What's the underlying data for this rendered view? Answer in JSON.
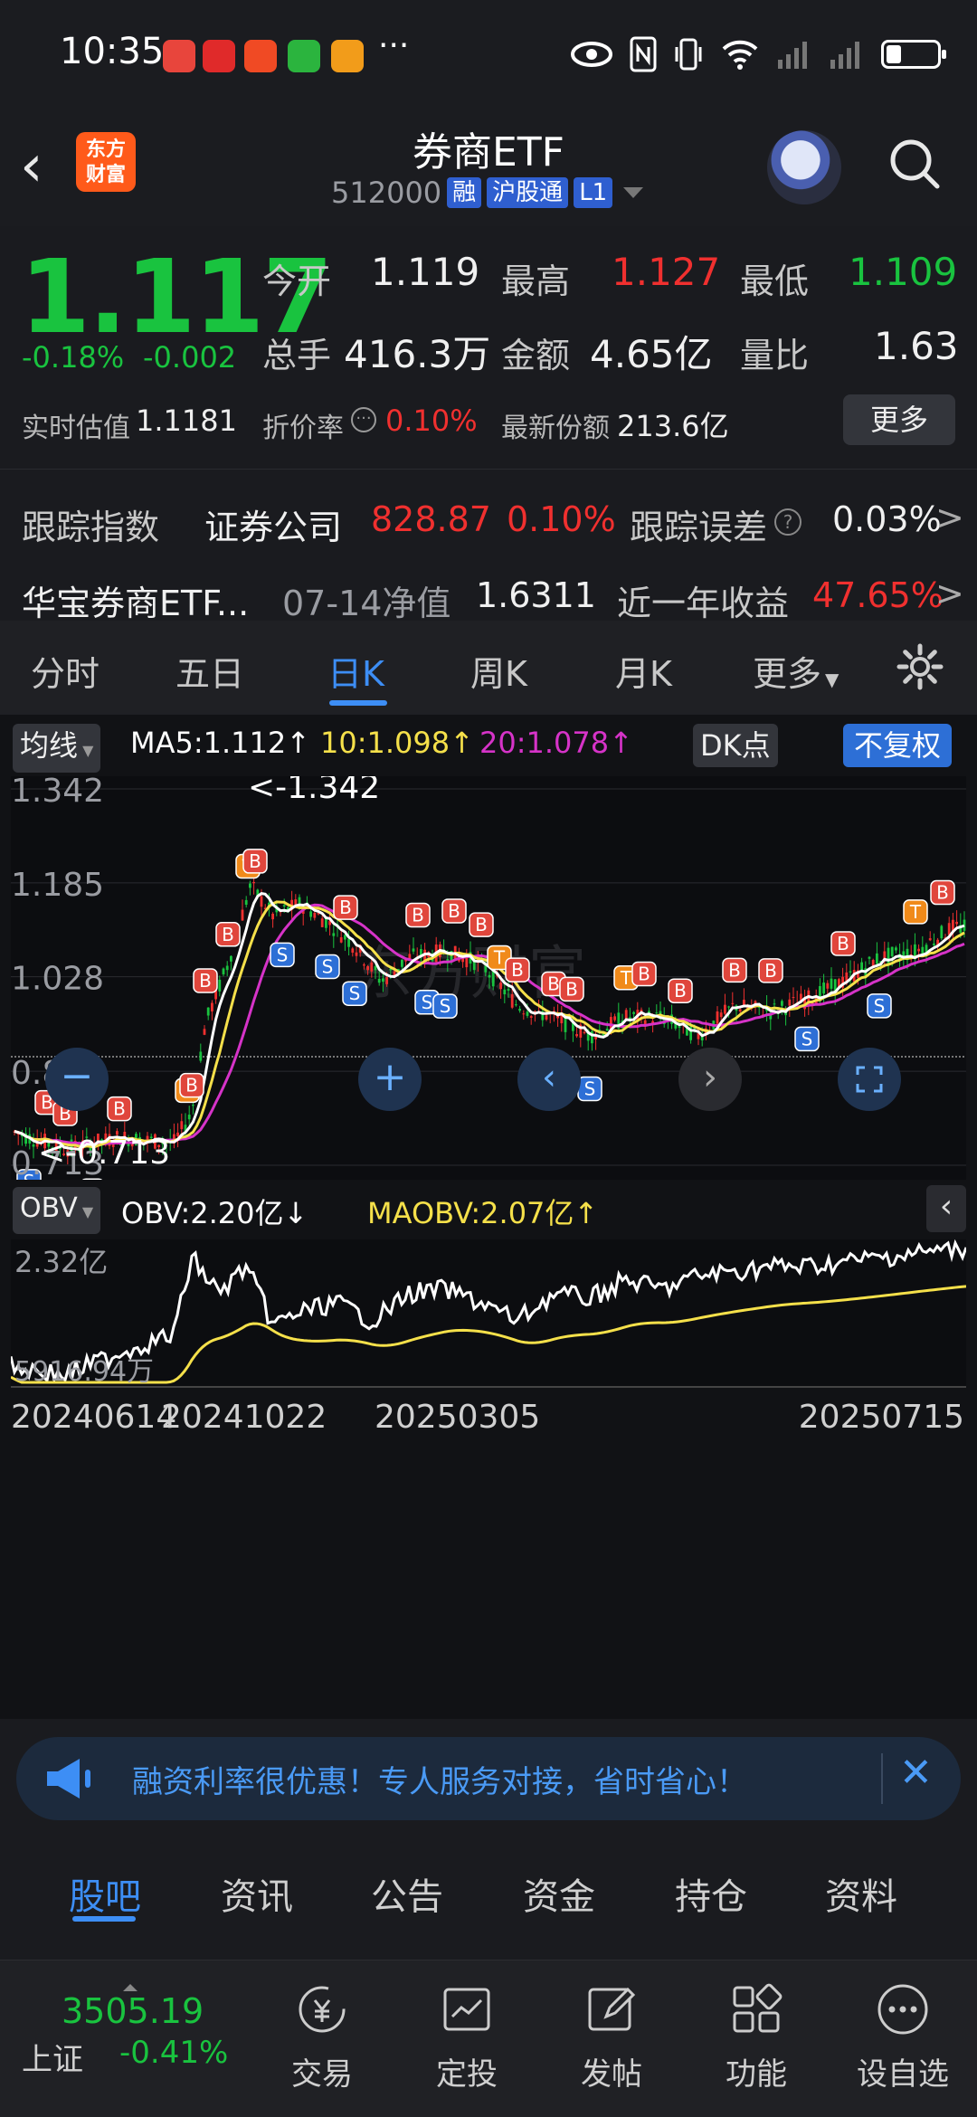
{
  "status_bar": {
    "time": "10:35",
    "dots": "···"
  },
  "header": {
    "brand": "东方\n财富",
    "title": "券商ETF",
    "code": "512000",
    "tags": [
      "融",
      "沪股通",
      "L1"
    ]
  },
  "quote": {
    "price": "1.117",
    "change_pct": "-0.18%",
    "change_abs": "-0.002",
    "open_label": "今开",
    "open": "1.119",
    "high_label": "最高",
    "high": "1.127",
    "low_label": "最低",
    "low": "1.109",
    "volume_label": "总手",
    "volume": "416.3万",
    "amount_label": "金额",
    "amount": "4.65亿",
    "ratio_label": "量比",
    "ratio": "1.63",
    "iopv_label": "实时估值",
    "iopv": "1.1181",
    "premium_label": "折价率",
    "premium": "0.10%",
    "shares_label": "最新份额",
    "shares": "213.6亿",
    "more_label": "更多",
    "track_label": "跟踪指数",
    "track_name": "证券公司",
    "track_value": "828.87",
    "track_pct": "0.10%",
    "error_label": "跟踪误差",
    "error_value": "0.03%",
    "fund_name": "华宝券商ETF...",
    "nav_label": "07-14净值",
    "nav_value": "1.6311",
    "yr_label": "近一年收益",
    "yr_value": "47.65%"
  },
  "period_tabs": [
    "分时",
    "五日",
    "日K",
    "周K",
    "月K",
    "更多"
  ],
  "active_period": "日K",
  "indicator_bar": {
    "selector": "均线",
    "ma5": "MA5:1.112↑",
    "ma10": "10:1.098↑",
    "ma20": "20:1.078↑",
    "dk": "DK点",
    "adjust": "不复权"
  },
  "kline": {
    "y_labels": [
      "1.342",
      "1.185",
      "1.028",
      "0.870",
      "0.713"
    ],
    "max_label": "<-1.342",
    "min_label": "<-0.713",
    "watermark": "东方财富"
  },
  "obv_bar": {
    "selector": "OBV",
    "obv": "OBV:2.20亿↓",
    "maobv": "MAOBV:2.07亿↑",
    "y_top": "2.32亿",
    "y_bottom": "5916.94万"
  },
  "x_dates": [
    "20240614",
    "20241022",
    "20250305",
    "20250715"
  ],
  "colors": {
    "up": "#f0302f",
    "down": "#19c33f",
    "accent": "#3d8ef5",
    "ma5": "#ffffff",
    "ma10": "#f5e04a",
    "ma20": "#d633c8"
  },
  "banner": {
    "text": "融资利率很优惠！专人服务对接，省时省心！"
  },
  "bottom_tabs": [
    "股吧",
    "资讯",
    "公告",
    "资金",
    "持仓",
    "资料"
  ],
  "active_bottom_tab": "股吧",
  "bottom_nav": {
    "index_value": "3505.19",
    "index_name": "上证",
    "index_pct": "-0.41%",
    "items": [
      "交易",
      "定投",
      "发帖",
      "功能",
      "设自选"
    ]
  },
  "chart_data": {
    "type": "line",
    "x": [
      "20240614",
      "20241022",
      "20250305",
      "20250715"
    ],
    "series": [
      {
        "name": "MA5",
        "values": [
          0.74,
          1.14,
          0.98,
          1.112
        ]
      },
      {
        "name": "10",
        "values": [
          0.745,
          1.12,
          0.99,
          1.098
        ]
      },
      {
        "name": "20",
        "values": [
          0.75,
          1.09,
          1.0,
          1.078
        ]
      }
    ],
    "ylim": [
      0.713,
      1.342
    ]
  }
}
